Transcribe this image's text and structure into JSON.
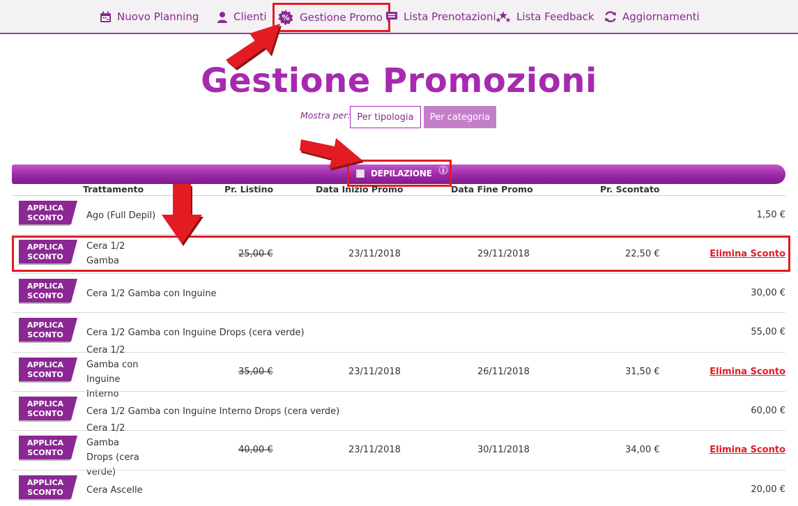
{
  "nav": {
    "items": [
      {
        "label": "Nuovo Planning",
        "icon": "calendar-icon"
      },
      {
        "label": "Clienti",
        "icon": "user-icon"
      },
      {
        "label": "Gestione Promo",
        "icon": "percent-badge-icon"
      },
      {
        "label": "Lista Prenotazioni",
        "icon": "list-icon"
      },
      {
        "label": "Lista Feedback",
        "icon": "stars-icon"
      },
      {
        "label": "Aggiornamenti",
        "icon": "refresh-icon"
      }
    ]
  },
  "page": {
    "title": "Gestione Promozioni"
  },
  "filter": {
    "label": "Mostra per:",
    "options": [
      "Per tipologia",
      "Per categoria"
    ],
    "selected": "Per categoria"
  },
  "category": {
    "name": "DEPILAZIONE"
  },
  "table": {
    "headers": {
      "trattamento": "Trattamento",
      "listino": "Pr. Listino",
      "inizio": "Data Inizio Promo",
      "fine": "Data Fine Promo",
      "scontato": "Pr. Scontato"
    },
    "applica_label_1": "APPLICA",
    "applica_label_2": "SCONTO",
    "rows": [
      {
        "name": "Ago (Full Depil)",
        "price": "1,50 €"
      },
      {
        "name": "Cera 1/2 Gamba",
        "listino": "25,00 €",
        "inizio": "23/11/2018",
        "fine": "29/11/2018",
        "scontato": "22,50 €",
        "action": "Elimina Sconto"
      },
      {
        "name": "Cera 1/2 Gamba con Inguine",
        "price": "30,00 €"
      },
      {
        "name": "Cera 1/2 Gamba con Inguine Drops (cera verde)",
        "price": "55,00 €"
      },
      {
        "name": "Cera 1/2 Gamba con Inguine Interno",
        "listino": "35,00 €",
        "inizio": "23/11/2018",
        "fine": "26/11/2018",
        "scontato": "31,50 €",
        "action": "Elimina Sconto"
      },
      {
        "name": "Cera 1/2 Gamba con Inguine Interno Drops (cera verde)",
        "price": "60,00 €"
      },
      {
        "name": "Cera 1/2 Gamba Drops (cera verde)",
        "listino": "40,00 €",
        "inizio": "23/11/2018",
        "fine": "30/11/2018",
        "scontato": "34,00 €",
        "action": "Elimina Sconto"
      },
      {
        "name": "Cera Ascelle",
        "price": "20,00 €"
      }
    ]
  },
  "colors": {
    "accent": "#a62ab0",
    "highlight": "#e31b23",
    "link": "#e31b23"
  }
}
